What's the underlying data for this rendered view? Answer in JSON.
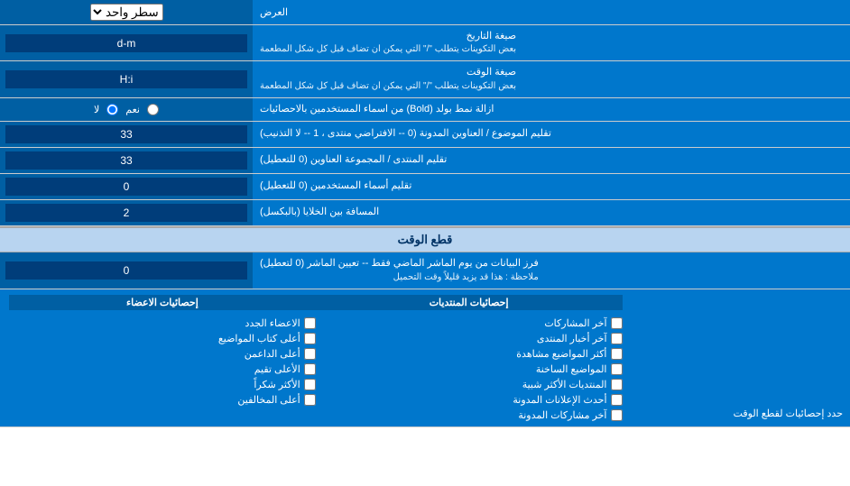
{
  "header": {
    "label": "العرض",
    "select_label": "سطر واحد"
  },
  "date_format": {
    "label": "صيغة التاريخ",
    "sublabel": "بعض التكوينات يتطلب \"/\" التي يمكن ان تضاف قبل كل شكل المطعمة",
    "value": "d-m"
  },
  "time_format": {
    "label": "صيغة الوقت",
    "sublabel": "بعض التكوينات يتطلب \"/\" التي يمكن ان تضاف قبل كل شكل المطعمة",
    "value": "H:i"
  },
  "bold_remove": {
    "label": "ازالة نمط بولد (Bold) من اسماء المستخدمين بالاحصائيات",
    "option_yes": "نعم",
    "option_no": "لا"
  },
  "topic_order": {
    "label": "تقليم الموضوع / العناوين المدونة (0 -- الافتراضي منتدى ، 1 -- لا التذنيب)",
    "value": "33"
  },
  "forum_order": {
    "label": "تقليم المنتدى / المجموعة العناوين (0 للتعطيل)",
    "value": "33"
  },
  "username_trim": {
    "label": "تقليم أسماء المستخدمين (0 للتعطيل)",
    "value": "0"
  },
  "cells_gap": {
    "label": "المسافة بين الخلايا (بالبكسل)",
    "value": "2"
  },
  "time_cutoff": {
    "section_label": "قطع الوقت",
    "label": "فرز البيانات من يوم الماشر الماضي فقط -- تعيين الماشر (0 لتعطيل)",
    "sublabel": "ملاحظة : هذا قد يزيد قليلاً وقت التحميل",
    "value": "0"
  },
  "stats_limit": {
    "label": "حدد إحصائيات لقطع الوقت"
  },
  "checkboxes": {
    "col1_header": "إحصائيات المنتديات",
    "col2_header": "إحصائيات الاعضاء",
    "col1": [
      "آخر المشاركات",
      "آخر أخبار المنتدى",
      "أكثر المواضيع مشاهدة",
      "المواضيع الساخنة",
      "المنتديات الأكثر شبية",
      "أحدث الإعلانات المدونة",
      "آخر مشاركات المدونة"
    ],
    "col2": [
      "الاعضاء الجدد",
      "أعلى كتاب المواضيع",
      "أعلى الداعمن",
      "الأعلى تقيم",
      "الأكثر شكراً",
      "أعلى المخالفين"
    ]
  }
}
